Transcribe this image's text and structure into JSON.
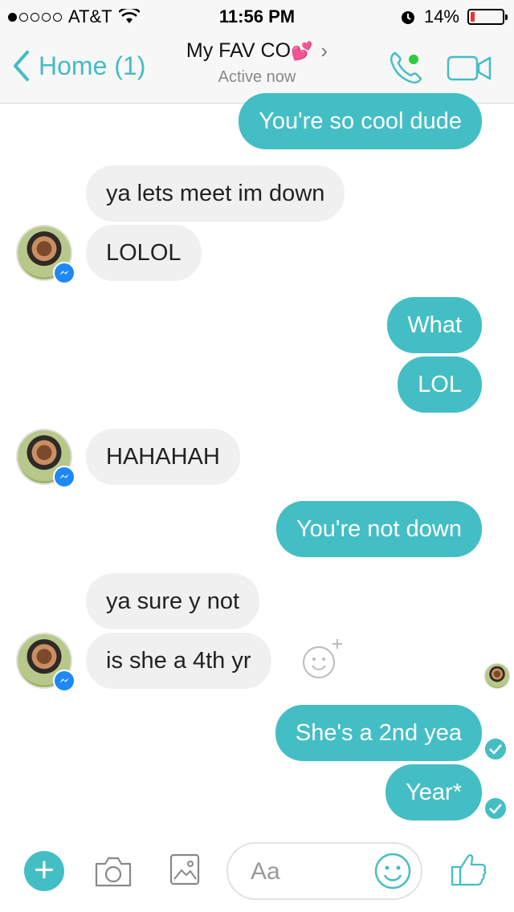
{
  "status_bar": {
    "carrier": "AT&T",
    "time": "11:56 PM",
    "battery": "14%",
    "battery_level": 0.14,
    "signal_bars": 1
  },
  "header": {
    "back_label": "Home (1)",
    "contact_name": "My FAV CO",
    "heart": "💕",
    "chevron": "›",
    "status": "Active now"
  },
  "messages": [
    {
      "dir": "out",
      "text": "You're so cool dude"
    },
    {
      "dir": "in",
      "text": "ya lets meet im down"
    },
    {
      "dir": "in",
      "text": "LOLOL"
    },
    {
      "dir": "out",
      "text": "What"
    },
    {
      "dir": "out",
      "text": "LOL"
    },
    {
      "dir": "in",
      "text": "HAHAHAH"
    },
    {
      "dir": "out",
      "text": "You're not down"
    },
    {
      "dir": "in",
      "text": "ya sure y not"
    },
    {
      "dir": "in",
      "text": "is she a 4th yr"
    },
    {
      "dir": "out",
      "text": "She's a 2nd yea"
    },
    {
      "dir": "out",
      "text": "Year*"
    }
  ],
  "composer": {
    "placeholder": "Aa",
    "plus": "+"
  },
  "colors": {
    "accent": "#44bec5",
    "incoming_bubble": "#f0f0f0",
    "messenger_blue": "#1e88f7"
  },
  "icons": [
    "back-chevron-icon",
    "phone-icon",
    "video-icon",
    "messenger-badge-icon",
    "add-reaction-icon",
    "delivered-check-icon",
    "camera-icon",
    "gallery-icon",
    "emoji-icon",
    "thumbs-up-icon"
  ]
}
